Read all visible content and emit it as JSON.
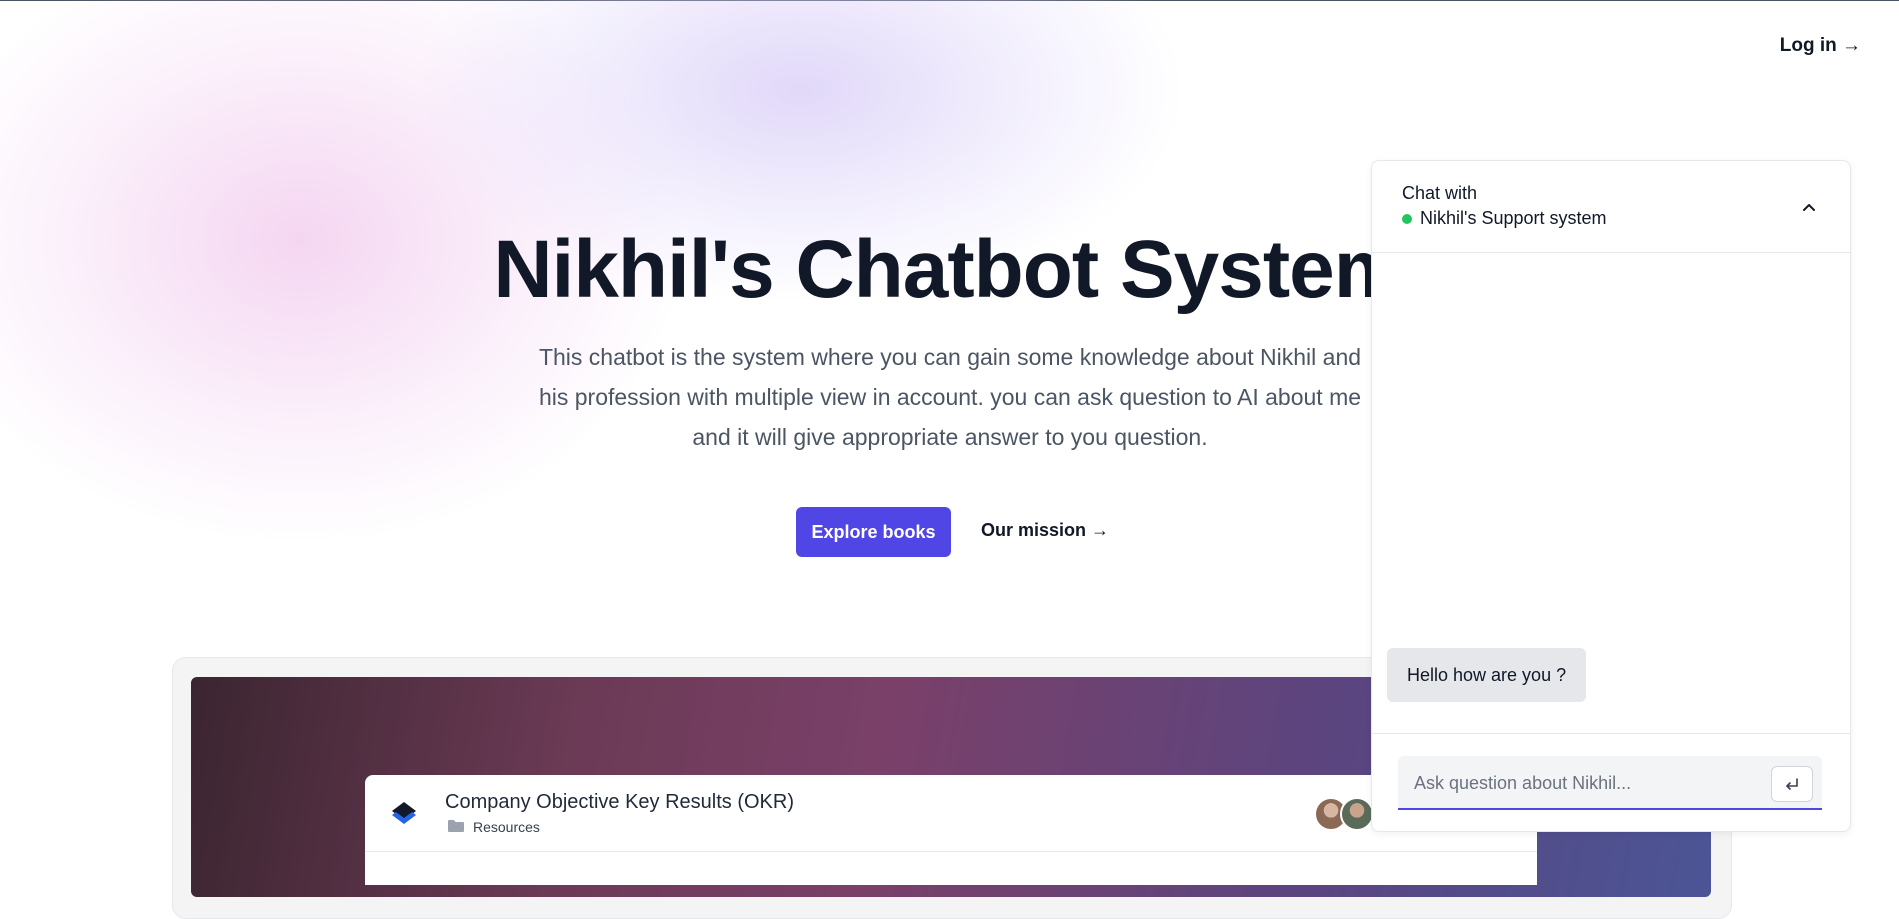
{
  "header": {
    "login_label": "Log in →"
  },
  "hero": {
    "title": "Nikhil's Chatbot System",
    "subtitle": "This chatbot is the system where you can gain some knowledge about Nikhil and his profession with multiple view in account. you can ask question to AI about me and it will give appropriate answer to you question.",
    "primary_button": "Explore books",
    "secondary_link": "Our mission →"
  },
  "preview": {
    "card_title": "Company Objective Key Results (OKR)",
    "folder_label": "Resources",
    "icons": {
      "logo": "layers-logo-icon",
      "folder": "folder-icon"
    }
  },
  "chat": {
    "header_line1": "Chat with",
    "header_name": "Nikhil's Support system",
    "status_color": "#22c55e",
    "messages": [
      {
        "text": "Hello how are you ?"
      }
    ],
    "input_placeholder": "Ask question about Nikhil...",
    "input_value": "",
    "icons": {
      "toggle": "chevron-up-icon",
      "send": "enter-icon"
    }
  },
  "colors": {
    "accent": "#4f46e5",
    "title": "#111827",
    "muted": "#4b5563"
  }
}
